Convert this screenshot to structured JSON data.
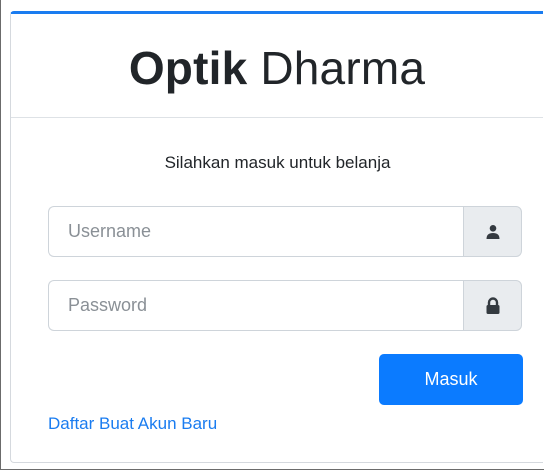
{
  "header": {
    "brand_bold": "Optik",
    "brand_light": "Dharma"
  },
  "login": {
    "message": "Silahkan masuk untuk belanja",
    "username_placeholder": "Username",
    "username_value": "",
    "username_icon": "user-icon",
    "password_placeholder": "Password",
    "password_value": "",
    "password_icon": "lock-icon",
    "submit_label": "Masuk",
    "register_link": "Daftar Buat Akun Baru"
  },
  "colors": {
    "accent": "#1a7cf0",
    "button": "#0b7bff",
    "addon_bg": "#e9ecef"
  }
}
